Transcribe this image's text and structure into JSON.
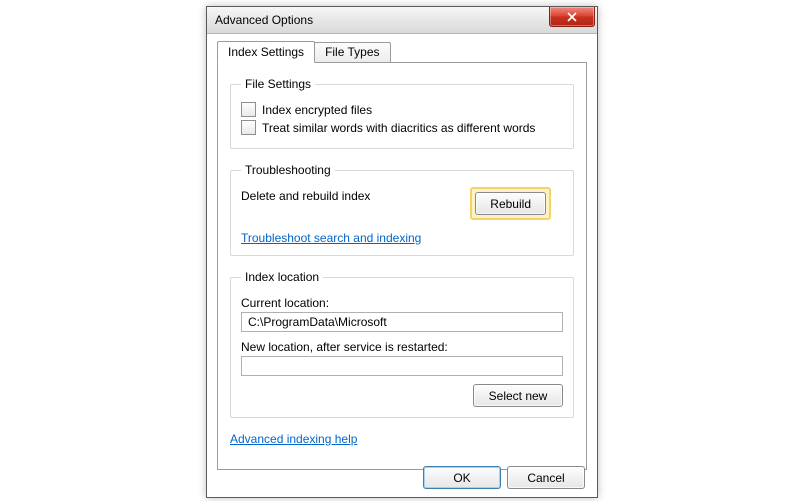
{
  "window": {
    "title": "Advanced Options"
  },
  "tabs": {
    "index_settings": "Index Settings",
    "file_types": "File Types"
  },
  "file_settings": {
    "legend": "File Settings",
    "index_encrypted": "Index encrypted files",
    "treat_diacritics": "Treat similar words with diacritics as different words"
  },
  "troubleshooting": {
    "legend": "Troubleshooting",
    "delete_rebuild": "Delete and rebuild index",
    "rebuild_btn": "Rebuild",
    "troubleshoot_link": "Troubleshoot search and indexing"
  },
  "index_location": {
    "legend": "Index location",
    "current_label": "Current location:",
    "current_value": "C:\\ProgramData\\Microsoft",
    "new_label": "New location, after service is restarted:",
    "new_value": "",
    "select_new_btn": "Select new"
  },
  "help_link": "Advanced indexing help",
  "buttons": {
    "ok": "OK",
    "cancel": "Cancel"
  }
}
